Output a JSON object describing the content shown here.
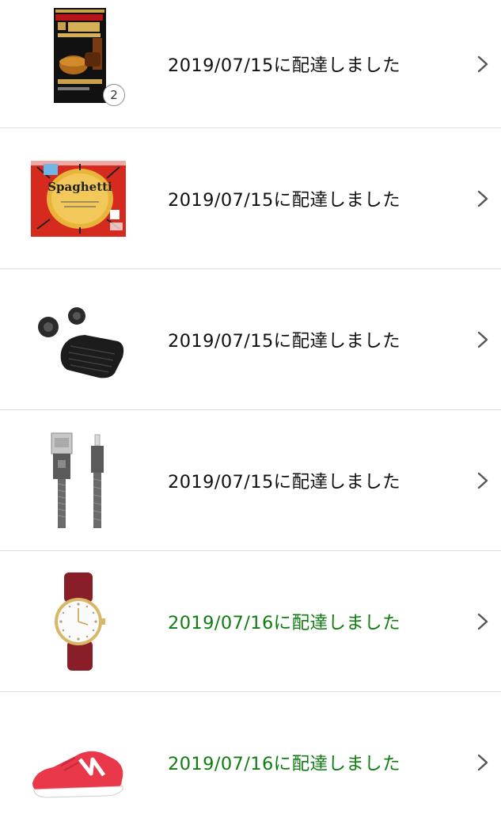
{
  "orders": [
    {
      "product_icon": "oolong-tea-bag-package",
      "quantity": "2",
      "status": "2019/07/15に配達しました",
      "status_color": "#111111",
      "chevron_icon": "chevron-right-icon"
    },
    {
      "product_icon": "spaghetti-package",
      "status": "2019/07/15に配達しました",
      "status_color": "#111111",
      "chevron_icon": "chevron-right-icon"
    },
    {
      "product_icon": "wireless-earbuds",
      "status": "2019/07/15に配達しました",
      "status_color": "#111111",
      "chevron_icon": "chevron-right-icon"
    },
    {
      "product_icon": "usb-lightning-cable",
      "status": "2019/07/15に配達しました",
      "status_color": "#111111",
      "chevron_icon": "chevron-right-icon"
    },
    {
      "product_icon": "red-leather-wristwatch",
      "status": "2019/07/16に配達しました",
      "status_color": "#0f7d0f",
      "chevron_icon": "chevron-right-icon"
    },
    {
      "product_icon": "red-running-sneaker",
      "status": "2019/07/16に配達しました",
      "status_color": "#0f7d0f",
      "chevron_icon": "chevron-right-icon"
    }
  ]
}
